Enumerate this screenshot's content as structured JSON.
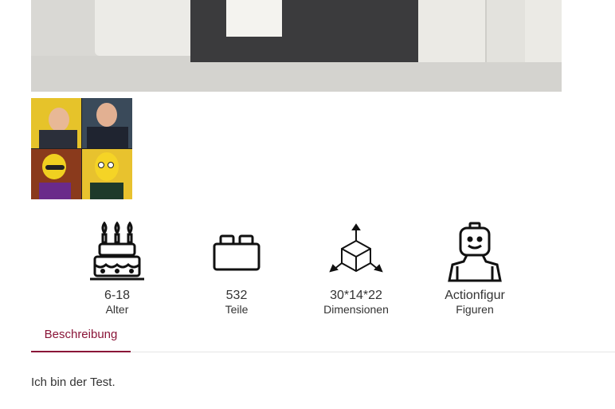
{
  "product": {
    "attributes": [
      {
        "icon": "cake-icon",
        "value": "6-18",
        "label": "Alter"
      },
      {
        "icon": "brick-icon",
        "value": "532",
        "label": "Teile"
      },
      {
        "icon": "dimensions-icon",
        "value": "30*14*22",
        "label": "Dimensionen"
      },
      {
        "icon": "minifigure-icon",
        "value": "Actionfigur",
        "label": "Figuren"
      }
    ]
  },
  "tabs": [
    {
      "label": "Beschreibung",
      "active": true
    }
  ],
  "description": {
    "text": "Ich bin der Test."
  },
  "colors": {
    "accent": "#8a1538",
    "text": "#333333",
    "divider": "#e5e5e5"
  }
}
